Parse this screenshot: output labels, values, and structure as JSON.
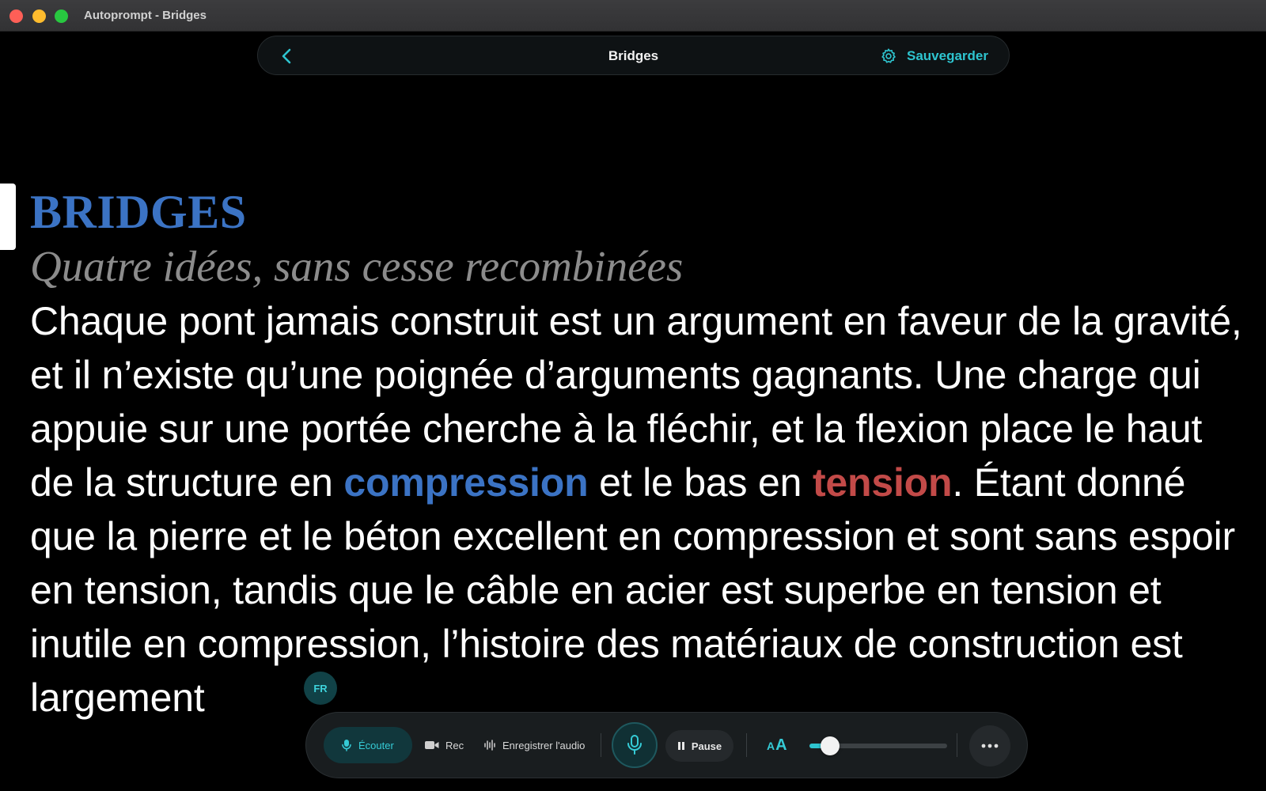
{
  "window": {
    "title": "Autoprompt - Bridges"
  },
  "nav": {
    "back_icon": "chevron-left-icon",
    "title": "Bridges",
    "save_label": "Sauvegarder",
    "save_icon": "gear-icon"
  },
  "document": {
    "title": "BRIDGES",
    "subtitle": "Quatre idées, sans cesse recombinées",
    "body_part1": "Chaque pont jamais construit est un argument en faveur de la gravité, et il n’existe qu’une poignée d’arguments gagnants. Une charge qui appuie sur une portée cherche à la fléchir, et la flexion place le haut de la structure en ",
    "keyword_compression": "compression",
    "body_part2": " et le bas en ",
    "keyword_tension": "tension",
    "body_part3": ". Étant donné que la pierre et le béton excellent en compression et sont sans espoir en tension, tandis que le câble en acier est superbe en tension et inutile en compression, l’histoire des matériaux de construction est largement"
  },
  "language_badge": "FR",
  "toolbar": {
    "ecouter_label": "Écouter",
    "rec_label": "Rec",
    "audio_label": "Enregistrer l'audio",
    "pause_label": "Pause",
    "font_small": "A",
    "font_large": "A",
    "font_size_level": 0.15
  },
  "colors": {
    "accent": "#2ec4cf",
    "compression": "#3b73c4",
    "tension": "#c24a48"
  }
}
